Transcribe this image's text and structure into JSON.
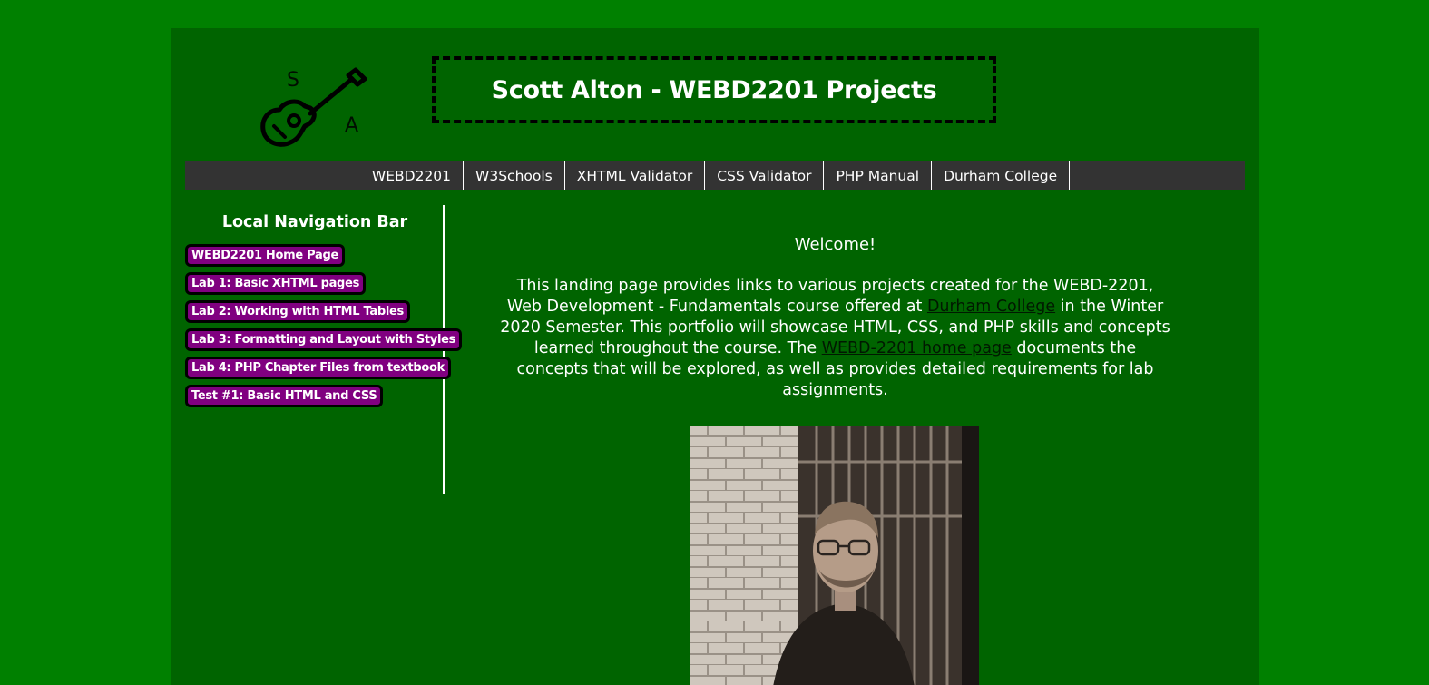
{
  "header": {
    "title": "Scott Alton - WEBD2201 Projects",
    "logo_letters": [
      "S",
      "A"
    ]
  },
  "topnav": {
    "items": [
      {
        "label": "WEBD2201"
      },
      {
        "label": "W3Schools"
      },
      {
        "label": "XHTML Validator"
      },
      {
        "label": "CSS Validator"
      },
      {
        "label": "PHP Manual"
      },
      {
        "label": "Durham College"
      }
    ]
  },
  "sidebar": {
    "heading": "Local Navigation Bar",
    "items": [
      {
        "label": "WEBD2201 Home Page"
      },
      {
        "label": "Lab 1: Basic XHTML pages"
      },
      {
        "label": "Lab 2: Working with HTML Tables"
      },
      {
        "label": "Lab 3: Formatting and Layout with Styles"
      },
      {
        "label": "Lab 4: PHP Chapter Files from textbook"
      },
      {
        "label": "Test #1: Basic HTML and CSS"
      }
    ]
  },
  "main": {
    "welcome": "Welcome!",
    "intro_part1": "This landing page provides links to various projects created for the WEBD-2201, Web Development - Fundamentals course offered at ",
    "link_durham": "Durham College",
    "intro_part2": " in the Winter 2020 Semester. This portfolio will showcase HTML, CSS, and PHP skills and concepts learned throughout the course. The ",
    "link_homepage": "WEBD-2201 home page",
    "intro_part3": " documents the concepts that will be explored, as well as provides detailed requirements for lab assignments."
  },
  "colors": {
    "outer_bg": "#008000",
    "page_bg": "#006400",
    "nav_bg": "#333333",
    "sidebar_button": "#800080"
  }
}
